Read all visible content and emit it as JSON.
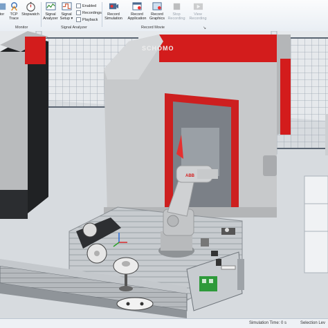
{
  "ribbon": {
    "buttons": {
      "tool": "tor",
      "tcp_trace": "TCP\nTrace",
      "stopwatch": "Stopwatch",
      "signal_analyzer": "Signal\nAnalyzer",
      "signal_setup": "Signal\nSetup ▾",
      "record_simulation": "Record\nSimulation",
      "record_application": "Record\nApplication",
      "record_graphics": "Record\nGraphics",
      "stop_recording": "Stop\nRecording",
      "view_recording": "View\nRecording"
    },
    "checkboxes": {
      "enabled": "Enabled",
      "recordings": "Recordings",
      "playback": "Playback"
    },
    "groups": {
      "monitor": "Monitor",
      "signal_analyzer": "Signal Analyzer",
      "record_movie": "Record Movie"
    },
    "launcher": "↘"
  },
  "viewport": {
    "wall_lettering": "SCHOMO",
    "robot_brand": "ABB"
  },
  "status": {
    "simulation_time": "Simulation Time: 0 s",
    "selection_level": "Selection Lev"
  },
  "colors": {
    "cabinet_red": "#d31c1c",
    "cabinet_grey": "#c9cacc",
    "robot_grey": "#b8babc",
    "floor": "#d6dade",
    "conveyor": "#8f9499",
    "board_green": "#2e9a3a"
  }
}
